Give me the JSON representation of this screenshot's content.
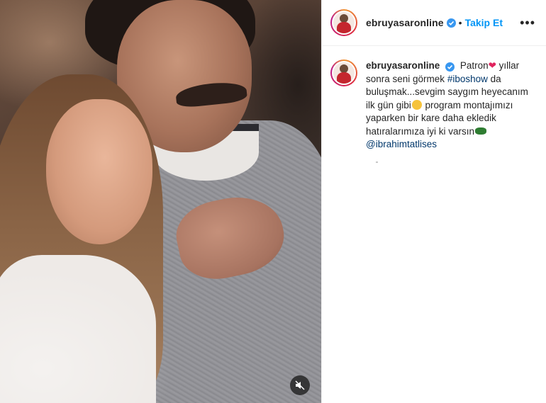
{
  "post": {
    "username": "ebruyasaronline",
    "separator": "•",
    "follow_label": "Takip Et",
    "more_label": "•••",
    "caption_segments": {
      "s1": "Patron",
      "heart": "❤",
      "s2": " yıllar sonra seni görmek ",
      "hashtag": "#iboshow",
      "s3": " da buluşmak...sevgim saygım heyecanım ilk gün gibi",
      "s4": " program montajımızı yaparken bir kare daha ekledik hatıralarımıza iyi ki varsın",
      "mention": "@ibrahimtatlises"
    }
  },
  "icons": {
    "verified": "verified-badge-icon",
    "mute": "speaker-muted-icon",
    "more": "more-options-icon"
  },
  "colors": {
    "link_blue": "#0095f6",
    "tag_blue": "#00376b",
    "verified_blue": "#3897f0",
    "heart_red": "#e0245e",
    "text": "#262626"
  }
}
